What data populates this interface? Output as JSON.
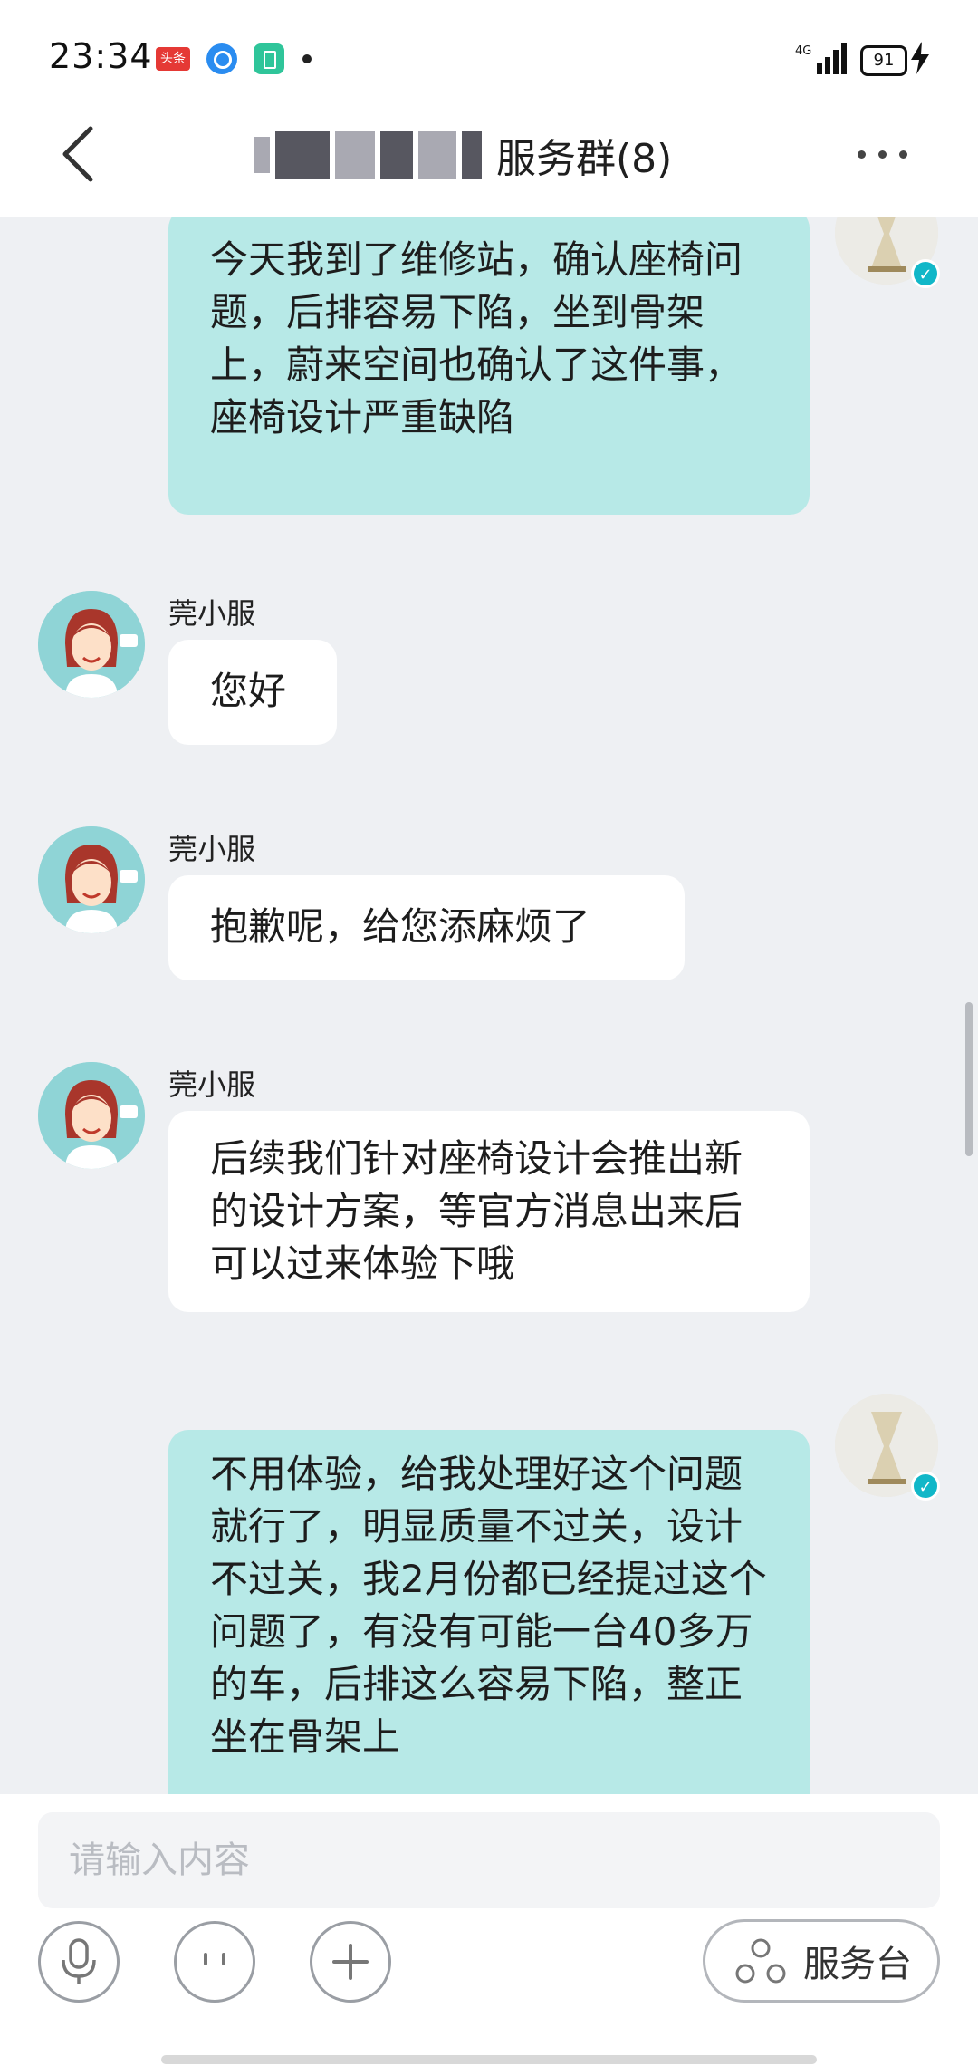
{
  "status_bar": {
    "time": "23:34",
    "app_badge": "头条",
    "network": "4G",
    "battery": "91"
  },
  "header": {
    "title": "服务群(8)"
  },
  "messages": [
    {
      "side": "right",
      "text": "今天我到了维修站，确认座椅问题，后排容易下陷，坐到骨架上，蔚来空间也确认了这件事，座椅设计严重缺陷"
    },
    {
      "side": "left",
      "sender": "莞小服",
      "text": "您好"
    },
    {
      "side": "left",
      "sender": "莞小服",
      "text": "抱歉呢，给您添麻烦了"
    },
    {
      "side": "left",
      "sender": "莞小服",
      "text": "后续我们针对座椅设计会推出新的设计方案，等官方消息出来后可以过来体验下哦"
    },
    {
      "side": "right",
      "text": "不用体验，给我处理好这个问题就行了，明显质量不过关，设计不过关，我2月份都已经提过这个问题了，有没有可能一台40多万的车，后排这么容易下陷，整正坐在骨架上"
    }
  ],
  "composer": {
    "placeholder": "请输入内容",
    "service_label": "服务台"
  },
  "icons": [
    "back-icon",
    "more-icon",
    "microphone-icon",
    "emoji-icon",
    "plus-icon",
    "service-desk-icon"
  ]
}
